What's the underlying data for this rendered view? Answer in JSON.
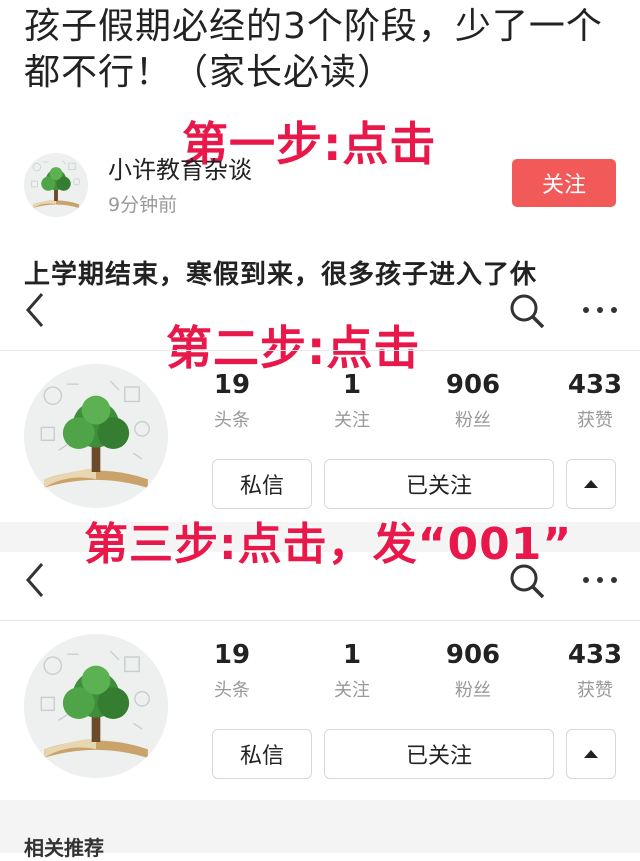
{
  "article": {
    "title": "孩子假期必经的3个阶段，少了一个都不行！（家长必读）",
    "intro": "上学期结束，寒假到来，很多孩子进入了休"
  },
  "author": {
    "name": "小许教育杂谈",
    "time": "9分钟前",
    "follow_label": "关注"
  },
  "steps": {
    "step1": "第一步:点击",
    "step2": "第二步:点击",
    "step3": "第三步:点击，发“001”"
  },
  "profiles": [
    {
      "stats": [
        {
          "num": "19",
          "label": "头条"
        },
        {
          "num": "1",
          "label": "关注"
        },
        {
          "num": "906",
          "label": "粉丝"
        },
        {
          "num": "433",
          "label": "获赞"
        }
      ],
      "message_label": "私信",
      "followed_label": "已关注"
    },
    {
      "stats": [
        {
          "num": "19",
          "label": "头条"
        },
        {
          "num": "1",
          "label": "关注"
        },
        {
          "num": "906",
          "label": "粉丝"
        },
        {
          "num": "433",
          "label": "获赞"
        }
      ],
      "message_label": "私信",
      "followed_label": "已关注"
    }
  ],
  "related_label": "相关推荐",
  "icons": [
    "back-icon",
    "search-icon",
    "more-icon",
    "caret-up-icon",
    "tree-book-avatar"
  ],
  "colors": {
    "accent_red": "#e8194a",
    "follow_red": "#f25a5a"
  }
}
